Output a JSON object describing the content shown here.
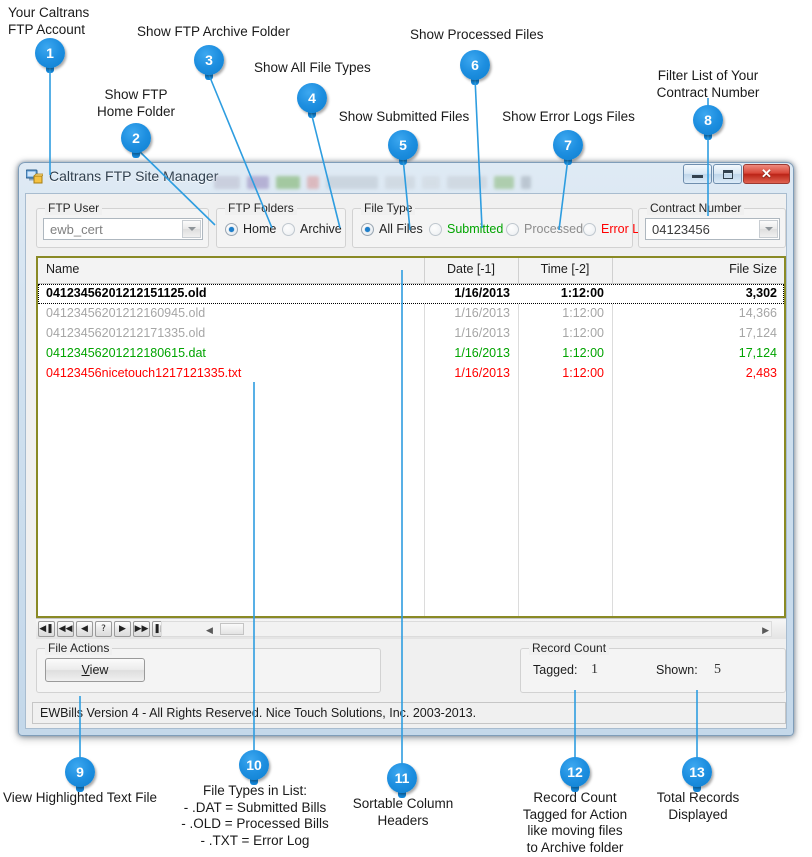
{
  "window": {
    "title": "Caltrans FTP Site Manager",
    "icon": "computer-ftp-icon",
    "buttons": {
      "minimize": "minimize",
      "maximize": "maximize",
      "close": "✕"
    }
  },
  "ftp_user": {
    "caption": "FTP User",
    "value": "ewb_cert"
  },
  "ftp_folders": {
    "caption": "FTP Folders",
    "options": [
      {
        "label": "Home",
        "selected": true
      },
      {
        "label": "Archive",
        "selected": false
      }
    ]
  },
  "file_type": {
    "caption": "File Type",
    "options": [
      {
        "label": "All Files",
        "selected": true,
        "color": "#222222"
      },
      {
        "label": "Submitted",
        "selected": false,
        "color": "#00a400"
      },
      {
        "label": "Processed",
        "selected": false,
        "color": "#8c8c8c"
      },
      {
        "label": "Error Logs",
        "selected": false,
        "color": "#ff0000"
      }
    ]
  },
  "contract_number": {
    "caption": "Contract Number",
    "value": "04123456"
  },
  "grid": {
    "columns": [
      "Name",
      "Date [-1]",
      "Time [-2]",
      "File Size"
    ],
    "rows": [
      {
        "name": "04123456201212151125.old",
        "date": "1/16/2013",
        "time": "1:12:00",
        "size": "3,302",
        "style": "selected"
      },
      {
        "name": "04123456201212160945.old",
        "date": "1/16/2013",
        "time": "1:12:00",
        "size": "14,366",
        "style": "gray"
      },
      {
        "name": "04123456201212171335.old",
        "date": "1/16/2013",
        "time": "1:12:00",
        "size": "17,124",
        "style": "gray"
      },
      {
        "name": "04123456201212180615.dat",
        "date": "1/16/2013",
        "time": "1:12:00",
        "size": "17,124",
        "style": "green"
      },
      {
        "name": "04123456nicetouch1217121335.txt",
        "date": "1/16/2013",
        "time": "1:12:00",
        "size": "2,483",
        "style": "red"
      }
    ]
  },
  "navigator": {
    "buttons": [
      {
        "name": "first-record",
        "glyph": "◀❚"
      },
      {
        "name": "prior-page",
        "glyph": "◀◀"
      },
      {
        "name": "prior-record",
        "glyph": "◀"
      },
      {
        "name": "help",
        "glyph": "?"
      },
      {
        "name": "next-record",
        "glyph": "▶"
      },
      {
        "name": "next-page",
        "glyph": "▶▶"
      },
      {
        "name": "last-record",
        "glyph": "❚▶"
      }
    ]
  },
  "file_actions": {
    "caption": "File Actions",
    "view_button": "View"
  },
  "record_count": {
    "caption": "Record Count",
    "tagged_label": "Tagged:",
    "tagged_value": "1",
    "shown_label": "Shown:",
    "shown_value": "5"
  },
  "status_bar": {
    "text": "EWBills Version 4 - All Rights Reserved. Nice Touch Solutions, Inc. 2003-2013."
  },
  "callouts": [
    {
      "n": "1",
      "text": "Your Caltrans\nFTP Account"
    },
    {
      "n": "2",
      "text": "Show FTP\nHome Folder"
    },
    {
      "n": "3",
      "text": "Show FTP Archive Folder"
    },
    {
      "n": "4",
      "text": "Show All File Types"
    },
    {
      "n": "5",
      "text": "Show Submitted Files"
    },
    {
      "n": "6",
      "text": "Show Processed Files"
    },
    {
      "n": "7",
      "text": "Show Error Logs Files"
    },
    {
      "n": "8",
      "text": "Filter List of Your\nContract Number"
    },
    {
      "n": "9",
      "text": "View Highlighted Text File"
    },
    {
      "n": "10",
      "text": "File Types in List:\n- .DAT = Submitted Bills\n- .OLD = Processed Bills\n- .TXT = Error Log"
    },
    {
      "n": "11",
      "text": "Sortable Column\nHeaders"
    },
    {
      "n": "12",
      "text": "Record Count\nTagged for Action\nlike moving files\nto Archive folder"
    },
    {
      "n": "13",
      "text": "Total Records\nDisplayed"
    }
  ],
  "theme": {
    "accent": "#1287da",
    "grid_border": "#8a8a25",
    "error": "#ff0000",
    "ok": "#00a400"
  }
}
